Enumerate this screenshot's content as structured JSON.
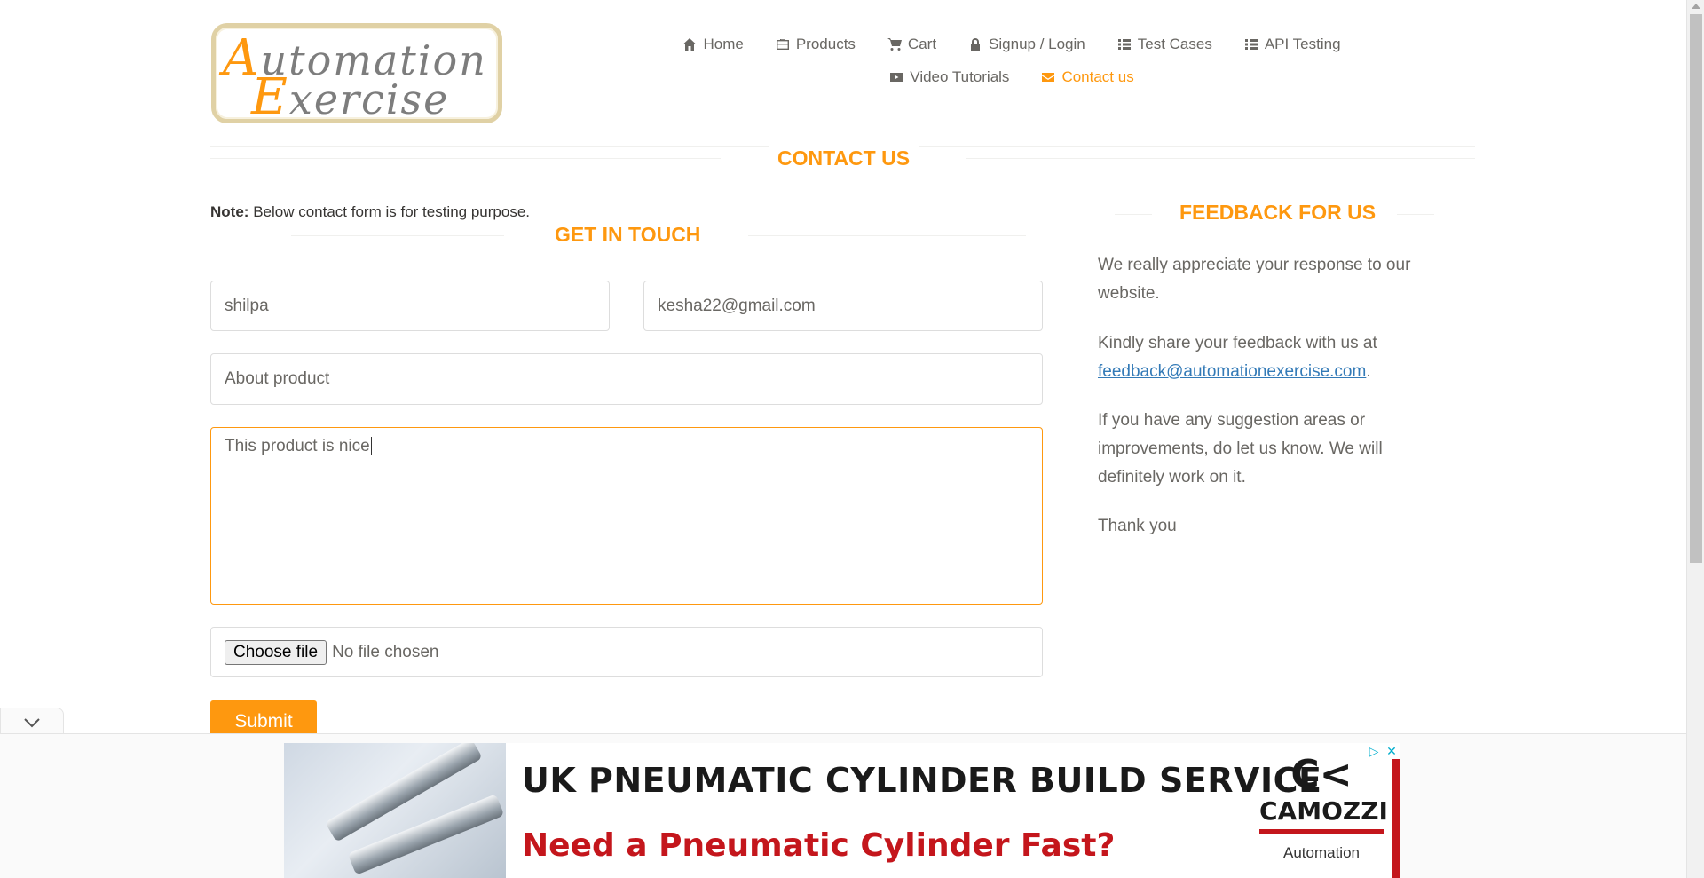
{
  "logo": {
    "alt": "Automation Exercise",
    "line1_cap": "A",
    "line1_rest": "utomation",
    "line2_cap": "E",
    "line2_rest": "xercise"
  },
  "nav": {
    "row1": [
      {
        "label": "Home",
        "icon": "home-icon"
      },
      {
        "label": "Products",
        "icon": "briefcase-icon"
      },
      {
        "label": "Cart",
        "icon": "cart-icon"
      },
      {
        "label": "Signup / Login",
        "icon": "lock-icon"
      },
      {
        "label": "Test Cases",
        "icon": "list-icon"
      },
      {
        "label": "API Testing",
        "icon": "list-icon"
      }
    ],
    "row2": [
      {
        "label": "Video Tutorials",
        "icon": "youtube-icon"
      },
      {
        "label": "Contact us",
        "icon": "envelope-icon",
        "active": true
      }
    ]
  },
  "page": {
    "title": "Contact Us"
  },
  "form": {
    "note_label": "Note:",
    "note_text": "Below contact form is for testing purpose.",
    "title": "Get In Touch",
    "name_value": "shilpa",
    "email_value": "kesha22@gmail.com",
    "subject_value": "About product",
    "message_value": "This product is nice",
    "file_button": "Choose file",
    "file_status": "No file chosen",
    "submit_label": "Submit"
  },
  "feedback": {
    "title": "Feedback For Us",
    "p1": "We really appreciate your response to our website.",
    "p2_prefix": "Kindly share your feedback with us at",
    "p2_email": "feedback@automationexercise.com",
    "p2_suffix": ".",
    "p3": "If you have any suggestion areas or improvements, do let us know. We will definitely work on it.",
    "p4": "Thank you"
  },
  "ad": {
    "headline": "UK PNEUMATIC CYLINDER BUILD SERVICE",
    "subline": "Need a Pneumatic Cylinder Fast?",
    "brand": "CAMOZZI",
    "brand_sub": "Automation",
    "brand_mark": "C<"
  },
  "colors": {
    "accent": "#fe980f",
    "text": "#696763",
    "link": "#337ab7",
    "ad_red": "#c4161c"
  }
}
